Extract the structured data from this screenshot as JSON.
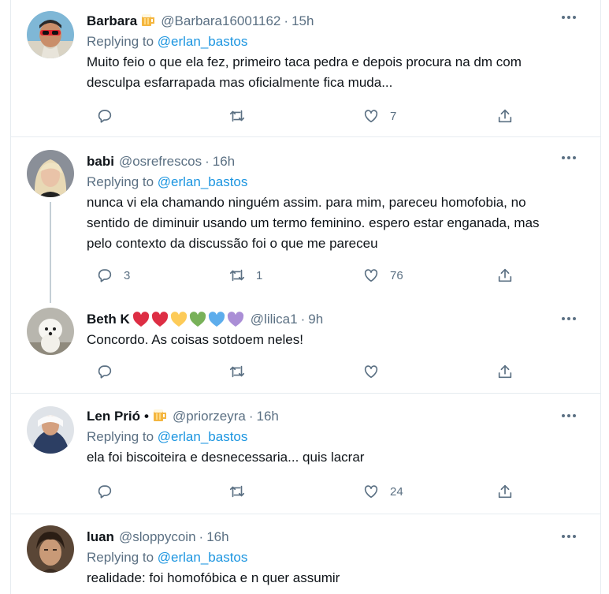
{
  "tweets": [
    {
      "name": "Barbara",
      "name_emoji": "beer-mug-icon",
      "handle": "@Barbara16001162",
      "time": "15h",
      "replying_prefix": "Replying to ",
      "replying_to": "@erlan_bastos",
      "text_lines": [
        "Muito feio o que ela fez, primeiro taca pedra e depois procura na dm com",
        "desculpa esfarrapada mas oficialmente fica muda..."
      ],
      "replies": "",
      "retweets": "",
      "likes": "7"
    },
    {
      "name": "babi",
      "handle": "@osrefrescos",
      "time": "16h",
      "replying_prefix": "Replying to ",
      "replying_to": "@erlan_bastos",
      "text_lines": [
        "nunca vi ela chamando ninguém assim. para mim, pareceu homofobia, no",
        "sentido de diminuir usando um termo feminino. espero estar enganada, mas",
        "pelo contexto da discussão foi o que me pareceu"
      ],
      "replies": "3",
      "retweets": "1",
      "likes": "76"
    },
    {
      "name": "Beth K",
      "name_hearts": [
        "#dd2e44",
        "#dd2e44",
        "#fdcb58",
        "#78b159",
        "#5dadec",
        "#aa8ed6"
      ],
      "handle": "@lilica1",
      "time": "9h",
      "text_lines": [
        "Concordo. As coisas sotdoem neles!"
      ],
      "replies": "",
      "retweets": "",
      "likes": ""
    },
    {
      "name": "Len Prió",
      "name_suffix": "•",
      "name_emoji": "beer-mug-icon",
      "handle": "@priorzeyra",
      "time": "16h",
      "replying_prefix": "Replying to ",
      "replying_to": "@erlan_bastos",
      "text_lines": [
        "ela foi biscoiteira e desnecessaria... quis lacrar"
      ],
      "replies": "",
      "retweets": "",
      "likes": "24"
    },
    {
      "name": "luan",
      "handle": "@sloppycoin",
      "time": "16h",
      "replying_prefix": "Replying to ",
      "replying_to": "@erlan_bastos",
      "text_lines": [
        "realidade: foi homofóbica e n quer assumir"
      ]
    }
  ],
  "separator": "·",
  "colors": {
    "link": "#1b95e0",
    "muted": "#5b7083",
    "border": "#e6ecf0"
  }
}
